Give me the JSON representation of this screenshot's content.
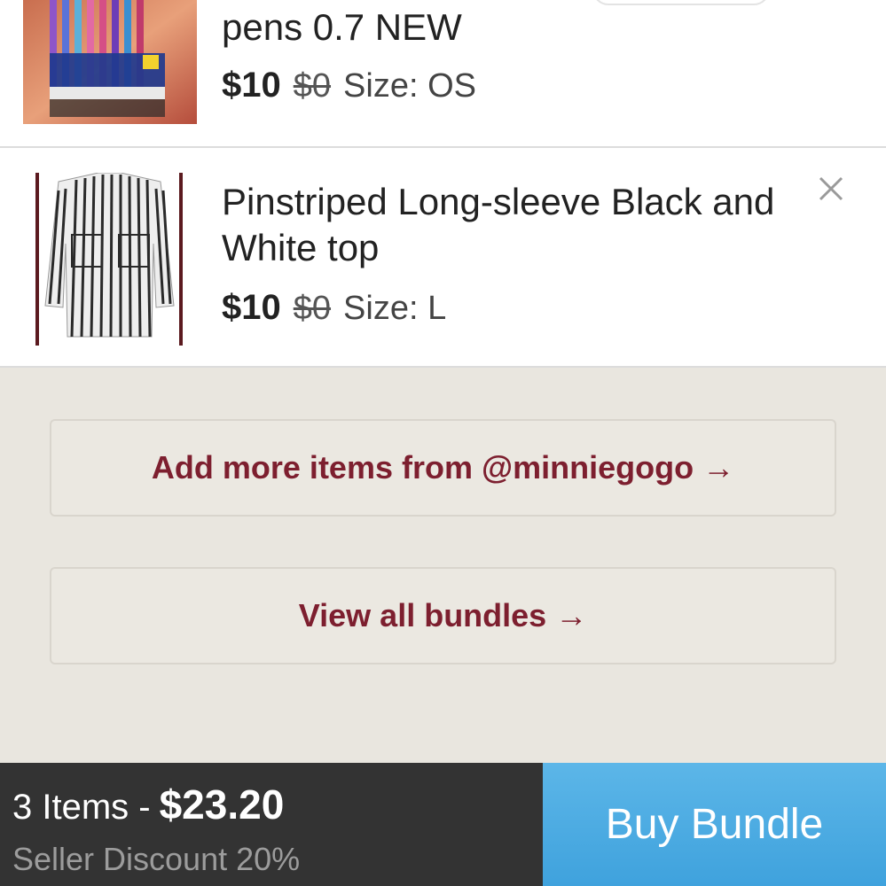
{
  "items": [
    {
      "title": "pens 0.7 NEW",
      "price": "$10",
      "original_price": "$0",
      "size": "Size: OS",
      "image_icon": "pen-pack-thumbnail"
    },
    {
      "title": "Pinstriped Long-sleeve Black and White top",
      "price": "$10",
      "original_price": "$0",
      "size": "Size: L",
      "image_icon": "striped-shirt-thumbnail"
    }
  ],
  "actions": {
    "add_more": "Add more items from @minniegogo →",
    "view_bundles": "View all bundles →"
  },
  "footer": {
    "items_label": "3 Items -",
    "total": "$23.20",
    "discount": "Seller Discount 20%",
    "buy_label": "Buy Bundle"
  },
  "colors": {
    "accent_text": "#7d1f2f",
    "buy_button": "#4aaae2",
    "summary_bg": "#333333"
  }
}
